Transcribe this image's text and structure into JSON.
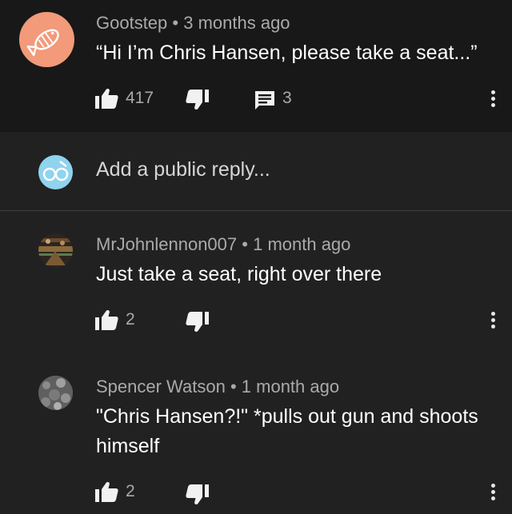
{
  "comments": [
    {
      "author": "Gootstep",
      "time": "3 months ago",
      "text": "“Hi I’m Chris Hansen, please take a seat...”",
      "likes": "417",
      "replies": "3",
      "avatar_color": "#f29a7a"
    },
    {
      "author": "MrJohnlennon007",
      "time": "1 month ago",
      "text": "Just take a seat, right over there",
      "likes": "2"
    },
    {
      "author": "Spencer Watson",
      "time": "1 month ago",
      "text_line1": "\"Chris Hansen?!\" *pulls out gun and shoots",
      "text_line2": "himself",
      "likes": "2"
    }
  ],
  "reply_box": {
    "placeholder": "Add a public reply..."
  },
  "separator": "•",
  "colors": {
    "background": "#212121",
    "top_comment_bg": "#181818",
    "secondary_text": "#aaaaaa",
    "user_avatar": "#8fd3ee"
  }
}
